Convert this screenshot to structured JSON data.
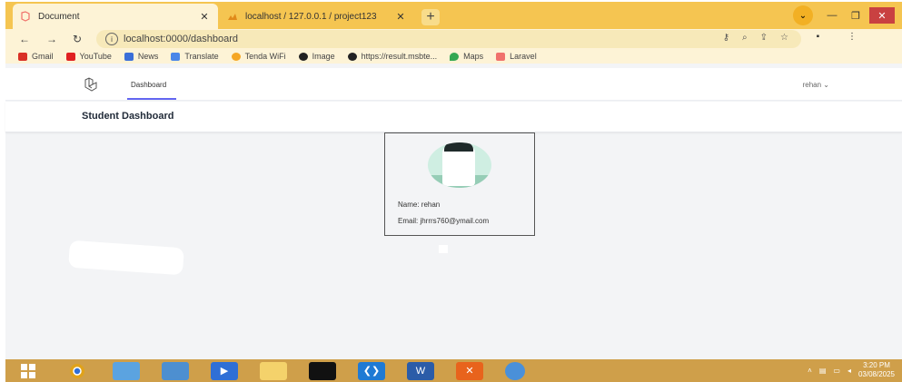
{
  "browser": {
    "tabs": [
      {
        "title": "Document",
        "active": true
      },
      {
        "title": "localhost / 127.0.0.1 / project123",
        "active": false
      }
    ],
    "url": "localhost:0000/dashboard",
    "bookmarks": [
      {
        "label": "Gmail",
        "color": "#d93025"
      },
      {
        "label": "YouTube",
        "color": "#e02020"
      },
      {
        "label": "News",
        "color": "#3b6fd8"
      },
      {
        "label": "Translate",
        "color": "#4a86e8"
      },
      {
        "label": "Tenda WiFi",
        "color": "#f5a623"
      },
      {
        "label": "Image",
        "color": "#222222"
      },
      {
        "label": "https://result.msbte...",
        "color": "#222222"
      },
      {
        "label": "Maps",
        "color": "#34a853"
      },
      {
        "label": "Laravel",
        "color": "#f0716b"
      }
    ]
  },
  "app": {
    "nav_link": "Dashboard",
    "user": "rehan",
    "header_title": "Student Dashboard",
    "accent": "#6366f1"
  },
  "profile": {
    "name_line": "Name: rehan",
    "email_line": "Email: jhrrrs760@ymail.com"
  },
  "taskbar": {
    "apps": [
      {
        "icon": "windows-start-icon",
        "color": "#2f6fd6"
      },
      {
        "icon": "chrome-icon",
        "color": "#e0a21a"
      },
      {
        "icon": "photos-icon",
        "color": "#5ba3e0"
      },
      {
        "icon": "paint-icon",
        "color": "#4d8fd0"
      },
      {
        "icon": "media-player-icon",
        "color": "#2f6fd6"
      },
      {
        "icon": "file-explorer-icon",
        "color": "#f4d26b"
      },
      {
        "icon": "terminal-icon",
        "color": "#111111"
      },
      {
        "icon": "vscode-icon",
        "color": "#1f7ad4"
      },
      {
        "icon": "word-icon",
        "color": "#2b5ca8"
      },
      {
        "icon": "xampp-icon",
        "color": "#e8631c"
      },
      {
        "icon": "chrome-profile-icon",
        "color": "#4a90d9"
      }
    ],
    "time": "3:20 PM",
    "date": "03/08/2025"
  }
}
